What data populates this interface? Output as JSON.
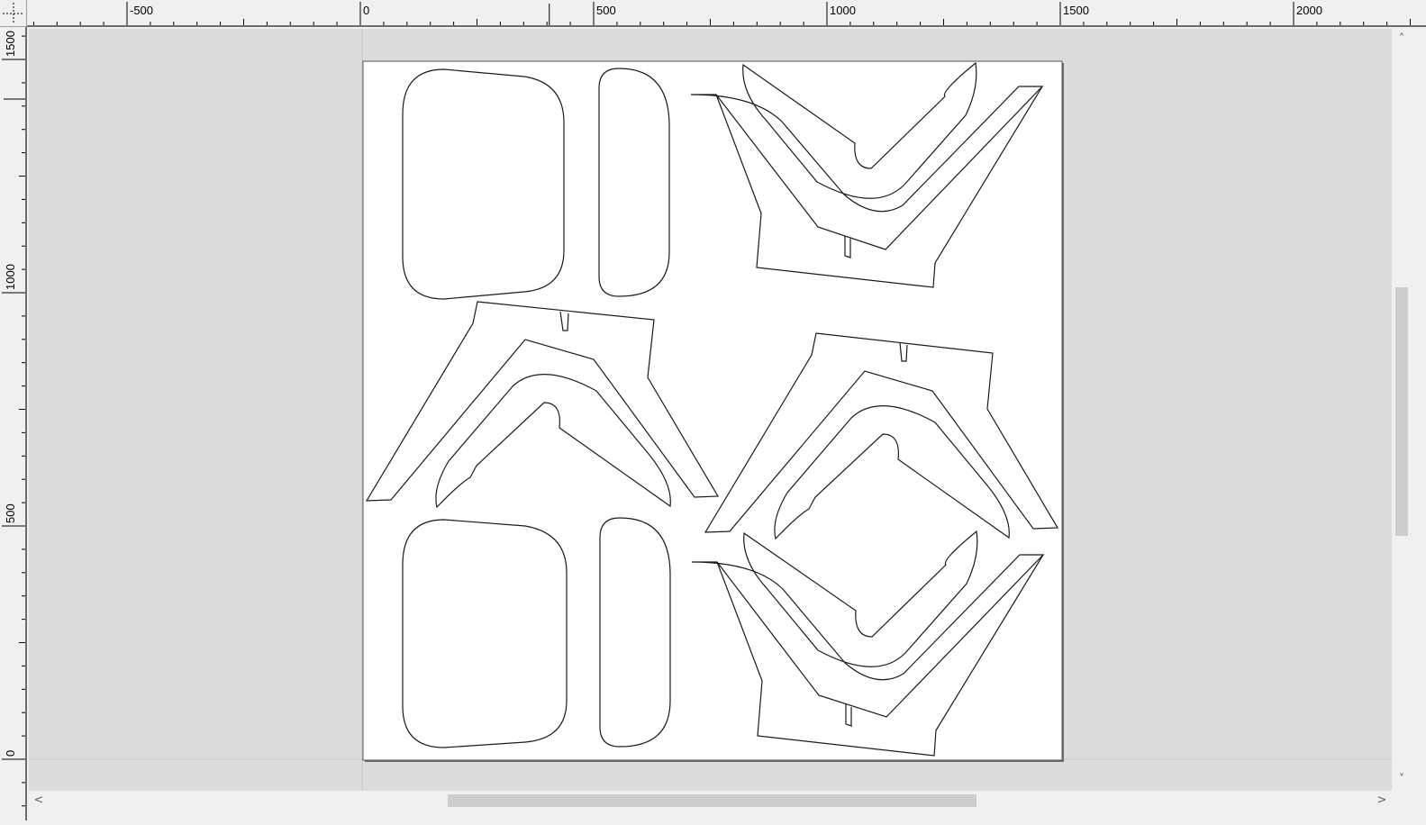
{
  "ruler_top": {
    "labels": [
      "-500",
      "0",
      "500",
      "1000",
      "1500",
      "2000"
    ],
    "values": [
      -500,
      0,
      500,
      1000,
      1500,
      2000
    ],
    "cursor_value": 405
  },
  "ruler_left": {
    "labels": [
      "1500",
      "1000",
      "500",
      "0"
    ],
    "values": [
      1500,
      1000,
      500,
      0
    ],
    "cursor_value": 1415
  },
  "scrollbars": {
    "up_arrow": "˄",
    "down_arrow": "˅",
    "left_arrow": "<",
    "right_arrow": ">"
  },
  "colors": {
    "canvas_bg": "#dcdcdc",
    "sheet": "#ffffff",
    "outline": "#1a1a1a",
    "ruler_bg": "#f0f0f0"
  },
  "icons": {
    "corner": "origin-crosshair-icon"
  }
}
